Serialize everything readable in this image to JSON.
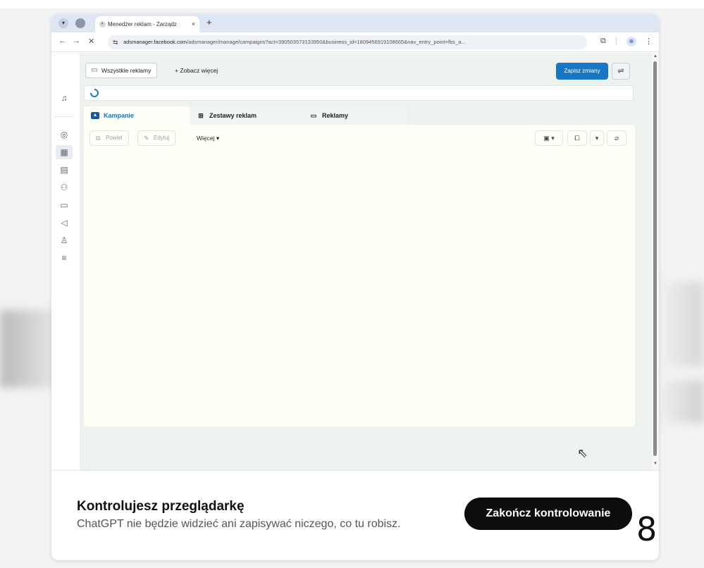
{
  "browser": {
    "tab_title": "Menedżer reklam - Zarządz",
    "tab_close": "×",
    "new_tab": "+",
    "url_host": "adsmanager.facebook.com",
    "url_path": "/adsmanager/manage/campaigns?act=390503573133950&business_id=1809456919108665&nav_entry_point=fbs_a...",
    "profile_initial": "⊕"
  },
  "topbar": {
    "all_ads_label": "Wszystkie reklamy",
    "see_more_label": "+ Zobacz więcej",
    "save_label": "Zapisz zmiany"
  },
  "tabs": [
    {
      "label": "Kampanie",
      "active": true
    },
    {
      "label": "Zestawy reklam",
      "active": false
    },
    {
      "label": "Reklamy",
      "active": false
    }
  ],
  "actions": {
    "duplicate_label": "Powiel",
    "edit_label": "Edytuj",
    "more_label": "Więcej ▾"
  },
  "overlay": {
    "title": "Kontrolujesz przeglądarkę",
    "subtitle": "ChatGPT nie będzie widzieć ani zapisywać niczego, co tu robisz.",
    "stop_label": "Zakończ kontrolowanie"
  },
  "corner_number": "8",
  "colors": {
    "accent": "#1877c5",
    "overlay_button": "#0d0d0d"
  }
}
